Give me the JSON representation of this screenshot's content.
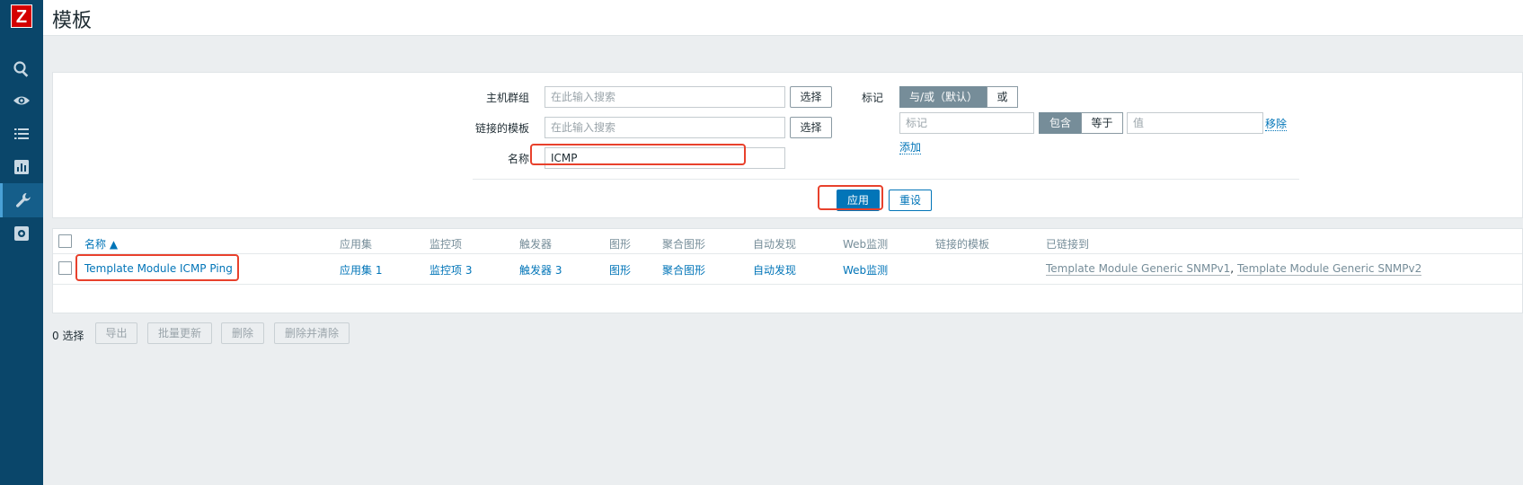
{
  "app": {
    "logo": "Z"
  },
  "header": {
    "title": "模板"
  },
  "sidebar": {
    "icons": [
      "search-icon",
      "eye-icon",
      "list-icon",
      "chart-icon",
      "wrench-icon",
      "gear-icon"
    ],
    "active": "wrench-icon"
  },
  "filter": {
    "host_group_label": "主机群组",
    "host_group_placeholder": "在此输入搜索",
    "linked_template_label": "链接的模板",
    "linked_template_placeholder": "在此输入搜索",
    "name_label": "名称",
    "name_value": "ICMP",
    "select_label": "选择",
    "tags_label": "标记",
    "tag_mode_and": "与/或（默认）",
    "tag_mode_or": "或",
    "tag_placeholder": "标记",
    "op_contains": "包含",
    "op_equals": "等于",
    "value_placeholder": "值",
    "remove_label": "移除",
    "add_label": "添加",
    "apply_label": "应用",
    "reset_label": "重设"
  },
  "table": {
    "columns": [
      "名称 ▲",
      "应用集",
      "监控项",
      "触发器",
      "图形",
      "聚合图形",
      "自动发现",
      "Web监测",
      "链接的模板",
      "已链接到"
    ],
    "rows": [
      {
        "name": "Template Module ICMP Ping",
        "applications": "应用集 1",
        "items": "监控项 3",
        "triggers": "触发器 3",
        "graphs": "图形",
        "screens": "聚合图形",
        "discovery": "自动发现",
        "web": "Web监测",
        "linked_templates": "",
        "linked_to_1": "Template Module Generic SNMPv1",
        "linked_to_sep": ",",
        "linked_to_2": "Template Module Generic SNMPv2"
      }
    ]
  },
  "footer": {
    "selected_count": "0 选择",
    "export_label": "导出",
    "mass_update_label": "批量更新",
    "delete_label": "删除",
    "delete_clear_label": "删除并清除"
  },
  "colors": {
    "sidebar": "#0a466a",
    "accent": "#0275b8",
    "highlight": "#e8412c",
    "logo": "#d40000"
  }
}
